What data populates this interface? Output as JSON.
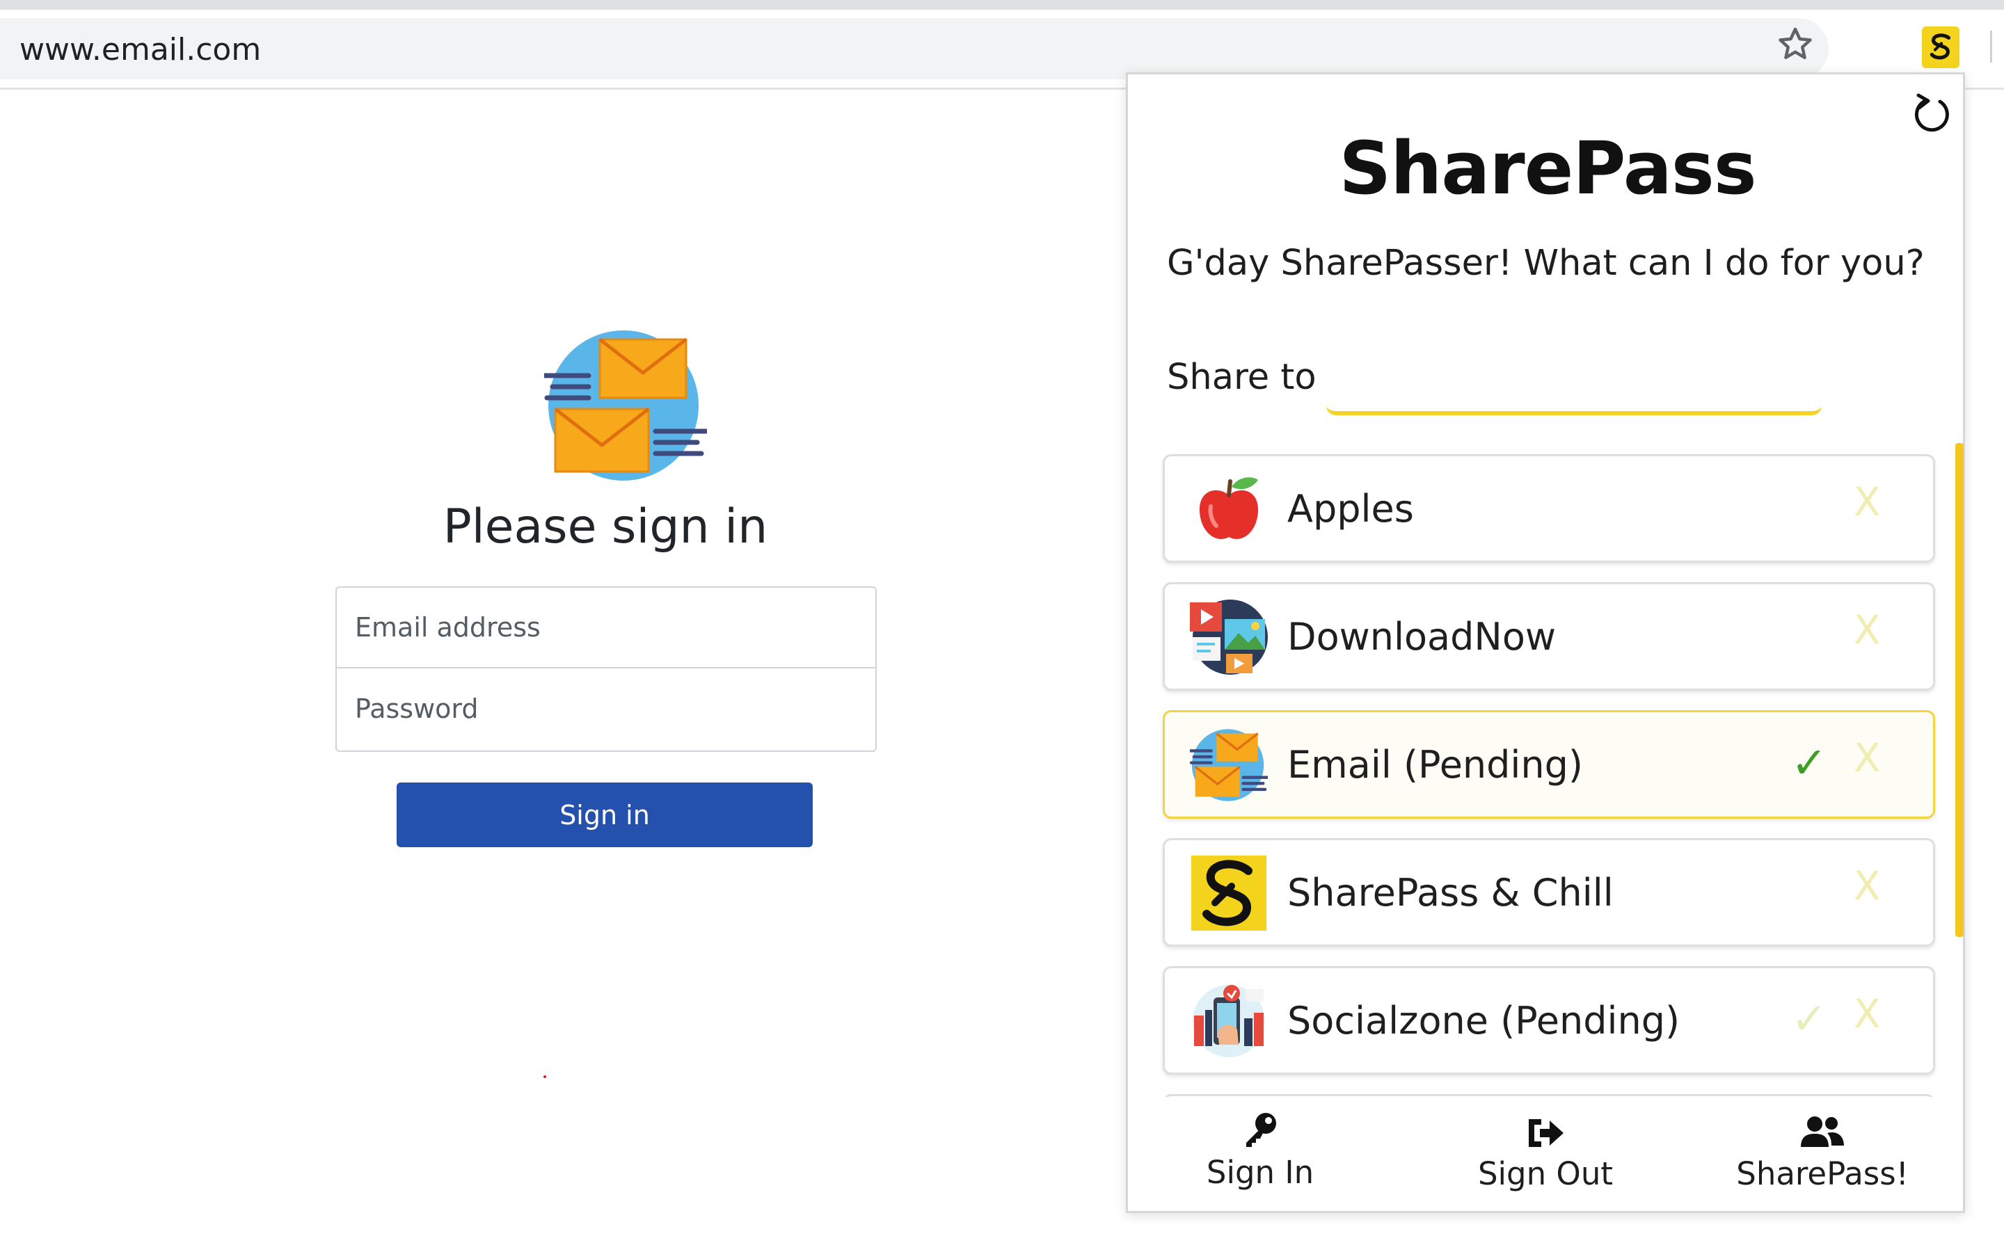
{
  "browser": {
    "url": "www.email.com",
    "icons": {
      "bookmark": "star-outline",
      "extension": "sharepass-logo"
    }
  },
  "signin_page": {
    "logo_icon": "email-envelopes",
    "title": "Please sign in",
    "email_placeholder": "Email address",
    "password_placeholder": "Password",
    "submit_label": "Sign in",
    "colors": {
      "button": "#2351ad",
      "title": "#212529"
    }
  },
  "popup": {
    "brand": "SharePass",
    "greeting": "G'day SharePasser! What can I do for you?",
    "share_to_label": "Share to",
    "share_to_value": "",
    "refresh_icon": "refresh",
    "accent_color": "#f5d322",
    "items": [
      {
        "label": "Apples",
        "icon": "apple",
        "checked": false,
        "check_faint": false,
        "selected": false,
        "remove_label": "X"
      },
      {
        "label": "DownloadNow",
        "icon": "media-gallery",
        "checked": false,
        "check_faint": false,
        "selected": false,
        "remove_label": "X"
      },
      {
        "label": "Email (Pending)",
        "icon": "email-envelopes",
        "checked": true,
        "check_faint": false,
        "selected": true,
        "remove_label": "X",
        "check_symbol": "✓"
      },
      {
        "label": "SharePass & Chill",
        "icon": "sharepass-logo",
        "checked": false,
        "check_faint": false,
        "selected": false,
        "remove_label": "X"
      },
      {
        "label": "Socialzone (Pending)",
        "icon": "social-network",
        "checked": true,
        "check_faint": true,
        "selected": false,
        "remove_label": "X",
        "check_symbol": "✓"
      }
    ],
    "nav": {
      "sign_in": {
        "label": "Sign In",
        "icon": "key"
      },
      "sign_out": {
        "label": "Sign Out",
        "icon": "sign-out"
      },
      "sharepass": {
        "label": "SharePass!",
        "icon": "users"
      }
    }
  }
}
